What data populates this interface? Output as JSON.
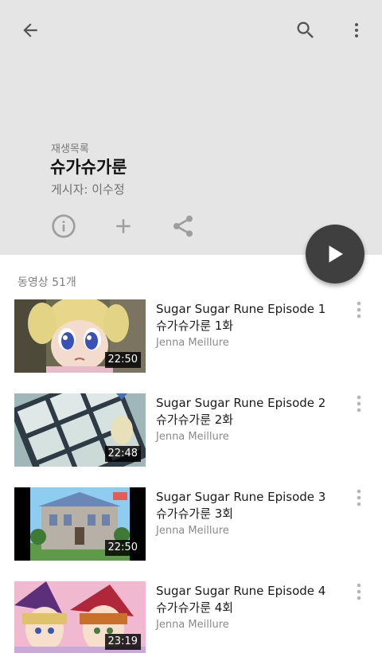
{
  "header": {
    "kicker": "재생목록",
    "title": "슈가슈가룬",
    "author": "게시자: 이수정"
  },
  "list": {
    "count_label": "동영상 51개",
    "videos": [
      {
        "title_line1": "Sugar Sugar Rune Episode 1",
        "title_line2": "슈가슈가룬 1화",
        "author": "Jenna Meillure",
        "duration": "22:50"
      },
      {
        "title_line1": "Sugar Sugar Rune Episode 2",
        "title_line2": "슈가슈가룬 2화",
        "author": "Jenna Meillure",
        "duration": "22:48"
      },
      {
        "title_line1": "Sugar Sugar Rune Episode 3",
        "title_line2": "슈가슈가룬 3회",
        "author": "Jenna Meillure",
        "duration": "22:50"
      },
      {
        "title_line1": "Sugar Sugar Rune Episode 4",
        "title_line2": "슈가슈가룬 4회",
        "author": "Jenna Meillure",
        "duration": "23:19"
      }
    ]
  },
  "icons": {
    "back": "arrow-back-icon",
    "search": "search-icon",
    "more": "more-vert-icon",
    "info": "info-icon",
    "add": "plus-icon",
    "share": "share-icon",
    "play": "play-icon"
  },
  "colors": {
    "header_bg": "#e5e5e5",
    "fab_bg": "#3f3f3f",
    "icon_gray": "#9e9e9e"
  }
}
